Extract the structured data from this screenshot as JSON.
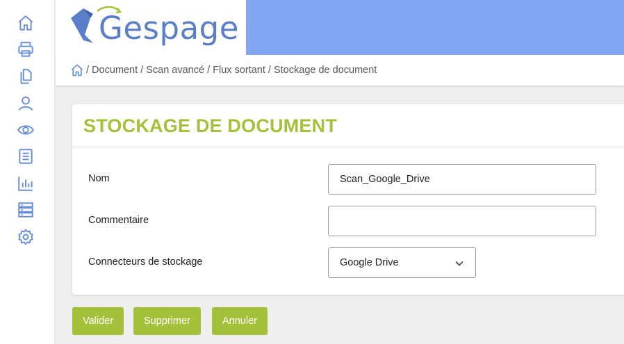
{
  "sidebar": {
    "items": [
      {
        "icon": "home-icon"
      },
      {
        "icon": "printer-icon"
      },
      {
        "icon": "documents-icon"
      },
      {
        "icon": "user-icon"
      },
      {
        "icon": "eye-icon"
      },
      {
        "icon": "book-icon"
      },
      {
        "icon": "chart-icon"
      },
      {
        "icon": "server-icon"
      },
      {
        "icon": "gear-icon"
      }
    ],
    "icon_color": "#6a8fd8"
  },
  "logo": {
    "text": "Gespage"
  },
  "colors": {
    "accent": "#a3c13a",
    "header": "#82a6f1",
    "icons": "#6a8fd8"
  },
  "breadcrumb": {
    "path": "/ Document / Scan avancé / Flux sortant / Stockage de document"
  },
  "form": {
    "title": "STOCKAGE DE DOCUMENT",
    "nom_label": "Nom",
    "nom_value": "Scan_Google_Drive",
    "commentaire_label": "Commentaire",
    "commentaire_value": "",
    "connecteurs_label": "Connecteurs de stockage",
    "connecteurs_value": "Google Drive"
  },
  "actions": {
    "valider": "Valider",
    "supprimer": "Supprimer",
    "annuler": "Annuler"
  }
}
